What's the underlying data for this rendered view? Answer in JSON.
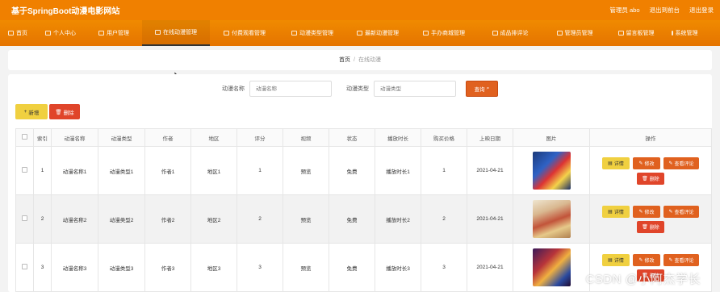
{
  "header": {
    "title": "基于SpringBoot动漫电影网站",
    "user_label": "管理员 abo",
    "backend_link": "退出到前台",
    "logout_link": "退出登录"
  },
  "nav": [
    {
      "label": "首页",
      "icon": "home-icon"
    },
    {
      "label": "个人中心",
      "icon": "user-icon"
    },
    {
      "label": "用户管理",
      "icon": "users-icon"
    },
    {
      "label": "在线动漫管理",
      "icon": "video-icon",
      "active": true
    },
    {
      "label": "付费观看管理",
      "icon": "pay-icon"
    },
    {
      "label": "动漫类型管理",
      "icon": "category-icon"
    },
    {
      "label": "最新动漫管理",
      "icon": "new-icon"
    },
    {
      "label": "手办商城管理",
      "icon": "shop-icon"
    },
    {
      "label": "成品排评论",
      "icon": "comment-icon"
    },
    {
      "label": "管理员管理",
      "icon": "admin-icon"
    },
    {
      "label": "留言板管理",
      "icon": "message-icon"
    },
    {
      "label": "系统管理",
      "icon": "settings-icon"
    }
  ],
  "breadcrumb": {
    "home": "首页",
    "separator": "/",
    "current": "在线动漫"
  },
  "search": {
    "name_label": "动漫名称",
    "name_placeholder": "动漫名称",
    "type_label": "动漫类型",
    "type_placeholder": "动漫类型",
    "query_button": "查询"
  },
  "toolbar": {
    "add": "新增",
    "delete": "删除"
  },
  "table": {
    "headers": [
      "索引",
      "动漫名称",
      "动漫类型",
      "作者",
      "地区",
      "评分",
      "视频",
      "状态",
      "播放时长",
      "购买价格",
      "上映日期",
      "图片",
      "操作"
    ],
    "rows": [
      {
        "index": "1",
        "name": "动漫名称1",
        "type": "动漫类型1",
        "author": "作者1",
        "region": "地区1",
        "score": "1",
        "video": "预览",
        "status": "免费",
        "duration": "播放时长1",
        "price": "1",
        "date": "2021-04-21"
      },
      {
        "index": "2",
        "name": "动漫名称2",
        "type": "动漫类型2",
        "author": "作者2",
        "region": "地区2",
        "score": "2",
        "video": "预览",
        "status": "免费",
        "duration": "播放时长2",
        "price": "2",
        "date": "2021-04-21"
      },
      {
        "index": "3",
        "name": "动漫名称3",
        "type": "动漫类型3",
        "author": "作者3",
        "region": "地区3",
        "score": "3",
        "video": "预览",
        "status": "免费",
        "duration": "播放时长3",
        "price": "3",
        "date": "2021-04-21"
      }
    ],
    "row_actions": {
      "detail": "详情",
      "edit": "修改",
      "comment": "查看评论",
      "remove": "删除"
    }
  },
  "watermark": "CSDN @小阿杰学长",
  "colors": {
    "primary": "#f08000",
    "danger": "#e0452a",
    "warning": "#f0d040",
    "action": "#e0611f",
    "preview": "#2eaa4a"
  }
}
